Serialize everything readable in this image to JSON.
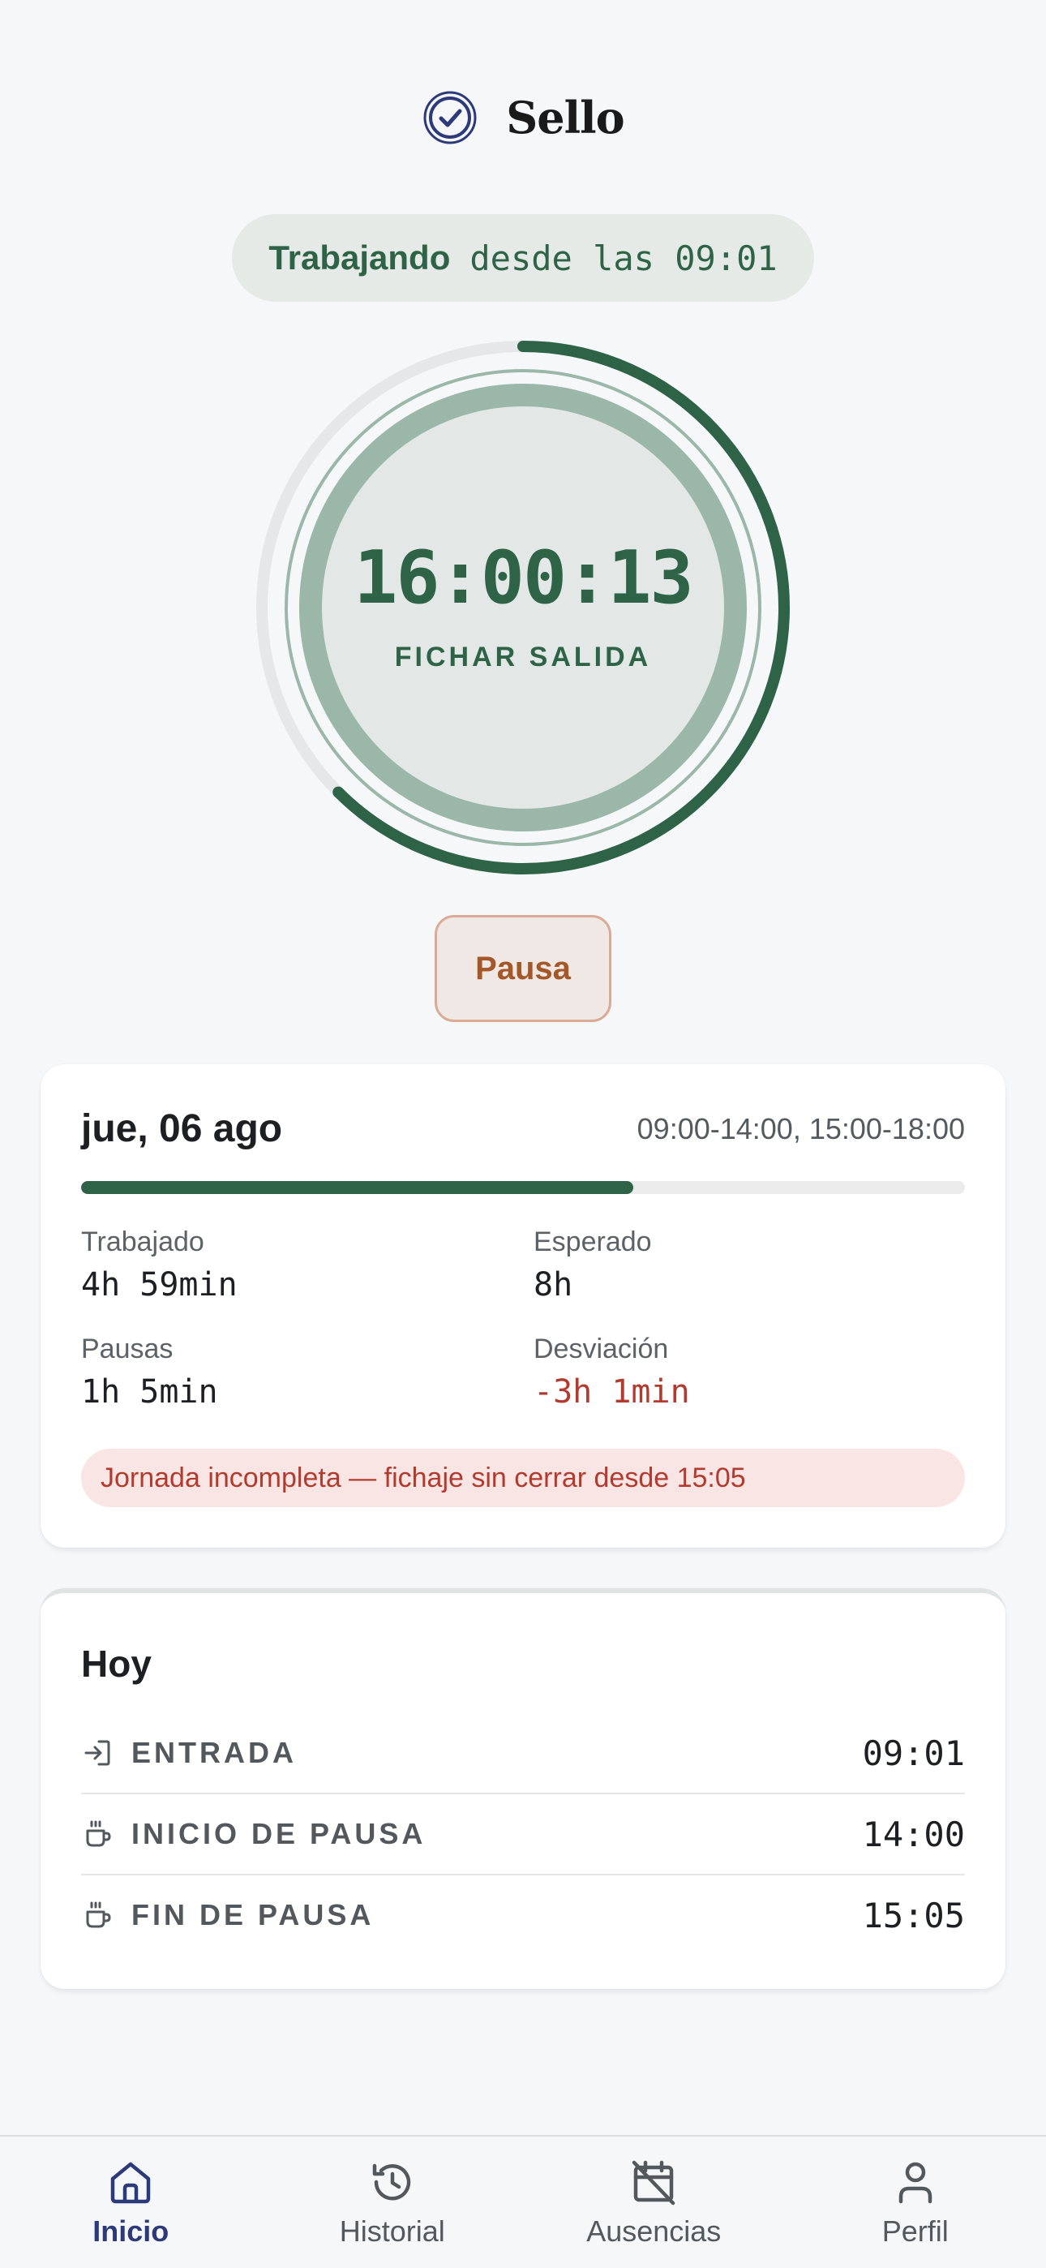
{
  "app": {
    "title": "Sello",
    "logo_icon": "check-circle-icon"
  },
  "status": {
    "state": "Trabajando",
    "since_text": "desde las 09:01"
  },
  "clock": {
    "time": "16:00:13",
    "action_label": "FICHAR SALIDA",
    "progress_fraction": 0.625
  },
  "pause_button": {
    "label": "Pausa"
  },
  "day": {
    "date": "jue, 06 ago",
    "schedule": "09:00-14:00, 15:00-18:00",
    "progress_fraction": 0.625,
    "stats": {
      "worked_label": "Trabajado",
      "worked_value": "4h 59min",
      "expected_label": "Esperado",
      "expected_value": "8h",
      "breaks_label": "Pausas",
      "breaks_value": "1h 5min",
      "deviation_label": "Desviación",
      "deviation_value": "-3h 1min"
    },
    "alert": "Jornada incompleta — fichaje sin cerrar desde 15:05"
  },
  "today": {
    "title": "Hoy",
    "entries": [
      {
        "icon": "login-arrow-icon",
        "label": "ENTRADA",
        "time": "09:01"
      },
      {
        "icon": "coffee-cup-icon",
        "label": "INICIO DE PAUSA",
        "time": "14:00"
      },
      {
        "icon": "coffee-cup-icon",
        "label": "FIN DE PAUSA",
        "time": "15:05"
      }
    ]
  },
  "nav": {
    "items": [
      {
        "icon": "home-icon",
        "label": "Inicio",
        "active": true
      },
      {
        "icon": "history-icon",
        "label": "Historial",
        "active": false
      },
      {
        "icon": "calendar-off-icon",
        "label": "Ausencias",
        "active": false
      },
      {
        "icon": "user-icon",
        "label": "Perfil",
        "active": false
      }
    ]
  },
  "colors": {
    "accent": "#2e6347",
    "nav_active": "#2d3a7a",
    "warning": "#b33a2e",
    "pause": "#a4582a",
    "background": "#f6f7f9"
  }
}
